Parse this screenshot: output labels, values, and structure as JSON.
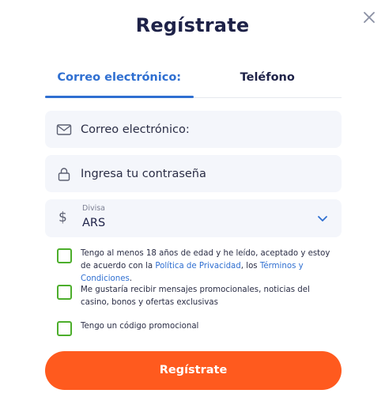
{
  "modal": {
    "title": "Regístrate",
    "close_icon": "close-icon"
  },
  "tabs": [
    {
      "label": "Correo electrónico:",
      "active": true
    },
    {
      "label": "Teléfono",
      "active": false
    }
  ],
  "form": {
    "email": {
      "icon": "mail-icon",
      "placeholder": "Correo electrónico:"
    },
    "password": {
      "icon": "lock-icon",
      "placeholder": "Ingresa tu contraseña"
    },
    "currency": {
      "icon": "dollar-icon",
      "symbol": "$",
      "label": "Divisa",
      "value": "ARS",
      "dropdown_icon": "chevron-down-icon"
    }
  },
  "checkboxes": {
    "terms": {
      "text_before": "Tengo al menos 18 años de edad y he leído, aceptado y estoy de acuerdo con la ",
      "privacy_link": "Política de Privacidad",
      "text_middle": ", los ",
      "terms_link": "Términos y Condiciones",
      "text_after": "."
    },
    "promos": {
      "text": "Me gustaría recibir mensajes promocionales, noticias del casino, bonos y ofertas exclusivas"
    },
    "promo_code": {
      "text": "Tengo un código promocional"
    }
  },
  "submit_label": "Regístrate",
  "colors": {
    "accent_blue": "#2f6fd1",
    "title_navy": "#1e2248",
    "cta_orange": "#ff5a1e",
    "checkbox_green": "#4cae2b",
    "field_bg": "#f4f6fb"
  }
}
